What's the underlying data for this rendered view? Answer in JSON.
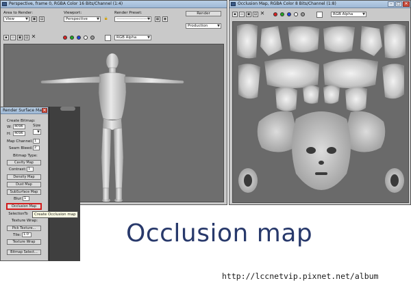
{
  "left_window": {
    "title": "Perspective, frame 0, RGBA Color 16 Bits/Channel (1:4)",
    "area_to_render_label": "Area to Render:",
    "area_to_render_value": "View",
    "viewport_label": "Viewport:",
    "viewport_value": "Perspective",
    "render_preset_label": "Render Preset:",
    "render_preset_value": "-------------------------",
    "render_button_label": "Render",
    "production_value": "Production",
    "channel_value": "RGB Alpha"
  },
  "right_window": {
    "title": "Occlusion Map, RGBA Color 8 Bits/Channel (1:8)",
    "channel_value": "RGB Alpha"
  },
  "rollout": {
    "title": "Render Surface Map",
    "create_bitmap_label": "Create Bitmap:",
    "w_label": "W:",
    "w_value": "4096",
    "h_label": "H:",
    "h_value": "4096",
    "size_label": "Size",
    "map_channel_label": "Map Channel:",
    "map_channel_value": "1",
    "seam_bleed_label": "Seam Bleed:",
    "seam_bleed_value": "2",
    "bitmap_type_label": "Bitmap Type:",
    "cavity_map": "Cavity Map",
    "contrast_label": "Contrast:",
    "contrast_value": "1",
    "density_map": "Density Map",
    "dust_map": "Dust Map",
    "subsurface_map": "SubSurface Map",
    "blur_label": "Blur:",
    "blur_value": "1",
    "occlusion_map": "Occlusion Map",
    "selection_to": "SelectionTo",
    "texture_wrap_label": "Texture Wrap:",
    "pick_texture": "Pick Texture...",
    "tile_label": "Tile:",
    "tile_value": "1.0",
    "texture_wrap": "Texture Wrap",
    "bitmap_select": "Bitmap Select..."
  },
  "tooltip": "Create Occlusion map",
  "overlay_caption": "Occlusion map",
  "url": "http://lccnetvip.pixnet.net/album",
  "colors": {
    "title_bar": "#b9cfe6",
    "panel_bg": "#c9c9c9",
    "viewport_bg": "#6e6e6e",
    "highlight_border": "#d11a1a",
    "caption_text": "#28396b"
  }
}
